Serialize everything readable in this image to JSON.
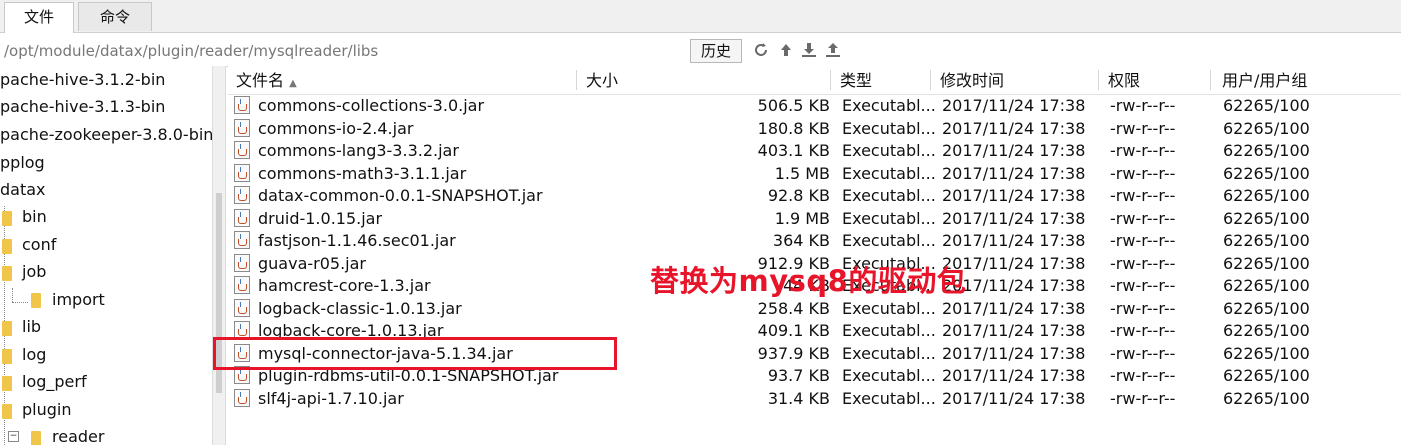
{
  "tabs": [
    {
      "label": "文件"
    },
    {
      "label": "命令"
    }
  ],
  "path": {
    "value": "/opt/module/datax/plugin/reader/mysqlreader/libs",
    "history_label": "历史"
  },
  "path_icons": [
    "refresh-icon",
    "up-icon",
    "download-icon",
    "upload-icon"
  ],
  "tree": [
    {
      "label": "pache-hive-3.1.2-bin"
    },
    {
      "label": "pache-hive-3.1.3-bin"
    },
    {
      "label": "pache-zookeeper-3.8.0-bin"
    },
    {
      "label": "pplog"
    },
    {
      "label": "datax"
    },
    {
      "label": "bin"
    },
    {
      "label": "conf"
    },
    {
      "label": "job"
    },
    {
      "label": "import"
    },
    {
      "label": "lib"
    },
    {
      "label": "log"
    },
    {
      "label": "log_perf"
    },
    {
      "label": "plugin"
    },
    {
      "label": "reader"
    }
  ],
  "columns": {
    "name": "文件名",
    "size": "大小",
    "type": "类型",
    "modified": "修改时间",
    "perms": "权限",
    "owner": "用户/用户组"
  },
  "files": [
    {
      "name": "commons-collections-3.0.jar",
      "size": "506.5 KB",
      "type": "Executabl...",
      "modified": "2017/11/24 17:38",
      "perms": "-rw-r--r--",
      "owner": "62265/100"
    },
    {
      "name": "commons-io-2.4.jar",
      "size": "180.8 KB",
      "type": "Executabl...",
      "modified": "2017/11/24 17:38",
      "perms": "-rw-r--r--",
      "owner": "62265/100"
    },
    {
      "name": "commons-lang3-3.3.2.jar",
      "size": "403.1 KB",
      "type": "Executabl...",
      "modified": "2017/11/24 17:38",
      "perms": "-rw-r--r--",
      "owner": "62265/100"
    },
    {
      "name": "commons-math3-3.1.1.jar",
      "size": "1.5 MB",
      "type": "Executabl...",
      "modified": "2017/11/24 17:38",
      "perms": "-rw-r--r--",
      "owner": "62265/100"
    },
    {
      "name": "datax-common-0.0.1-SNAPSHOT.jar",
      "size": "92.8 KB",
      "type": "Executabl...",
      "modified": "2017/11/24 17:38",
      "perms": "-rw-r--r--",
      "owner": "62265/100"
    },
    {
      "name": "druid-1.0.15.jar",
      "size": "1.9 MB",
      "type": "Executabl...",
      "modified": "2017/11/24 17:38",
      "perms": "-rw-r--r--",
      "owner": "62265/100"
    },
    {
      "name": "fastjson-1.1.46.sec01.jar",
      "size": "364 KB",
      "type": "Executabl...",
      "modified": "2017/11/24 17:38",
      "perms": "-rw-r--r--",
      "owner": "62265/100"
    },
    {
      "name": "guava-r05.jar",
      "size": "912.9 KB",
      "type": "Executabl...",
      "modified": "2017/11/24 17:38",
      "perms": "-rw-r--r--",
      "owner": "62265/100"
    },
    {
      "name": "hamcrest-core-1.3.jar",
      "size": "44 KB",
      "type": "Executabl...",
      "modified": "2017/11/24 17:38",
      "perms": "-rw-r--r--",
      "owner": "62265/100"
    },
    {
      "name": "logback-classic-1.0.13.jar",
      "size": "258.4 KB",
      "type": "Executabl...",
      "modified": "2017/11/24 17:38",
      "perms": "-rw-r--r--",
      "owner": "62265/100"
    },
    {
      "name": "logback-core-1.0.13.jar",
      "size": "409.1 KB",
      "type": "Executabl...",
      "modified": "2017/11/24 17:38",
      "perms": "-rw-r--r--",
      "owner": "62265/100"
    },
    {
      "name": "mysql-connector-java-5.1.34.jar",
      "size": "937.9 KB",
      "type": "Executabl...",
      "modified": "2017/11/24 17:38",
      "perms": "-rw-r--r--",
      "owner": "62265/100"
    },
    {
      "name": "plugin-rdbms-util-0.0.1-SNAPSHOT.jar",
      "size": "93.7 KB",
      "type": "Executabl...",
      "modified": "2017/11/24 17:38",
      "perms": "-rw-r--r--",
      "owner": "62265/100"
    },
    {
      "name": "slf4j-api-1.7.10.jar",
      "size": "31.4 KB",
      "type": "Executabl...",
      "modified": "2017/11/24 17:38",
      "perms": "-rw-r--r--",
      "owner": "62265/100"
    }
  ],
  "annotation": {
    "text": "替换为mysq8的驱动包",
    "color": "#e8152a"
  },
  "colors": {
    "accent_red": "#e8152a",
    "folder": "#f1c54a"
  }
}
